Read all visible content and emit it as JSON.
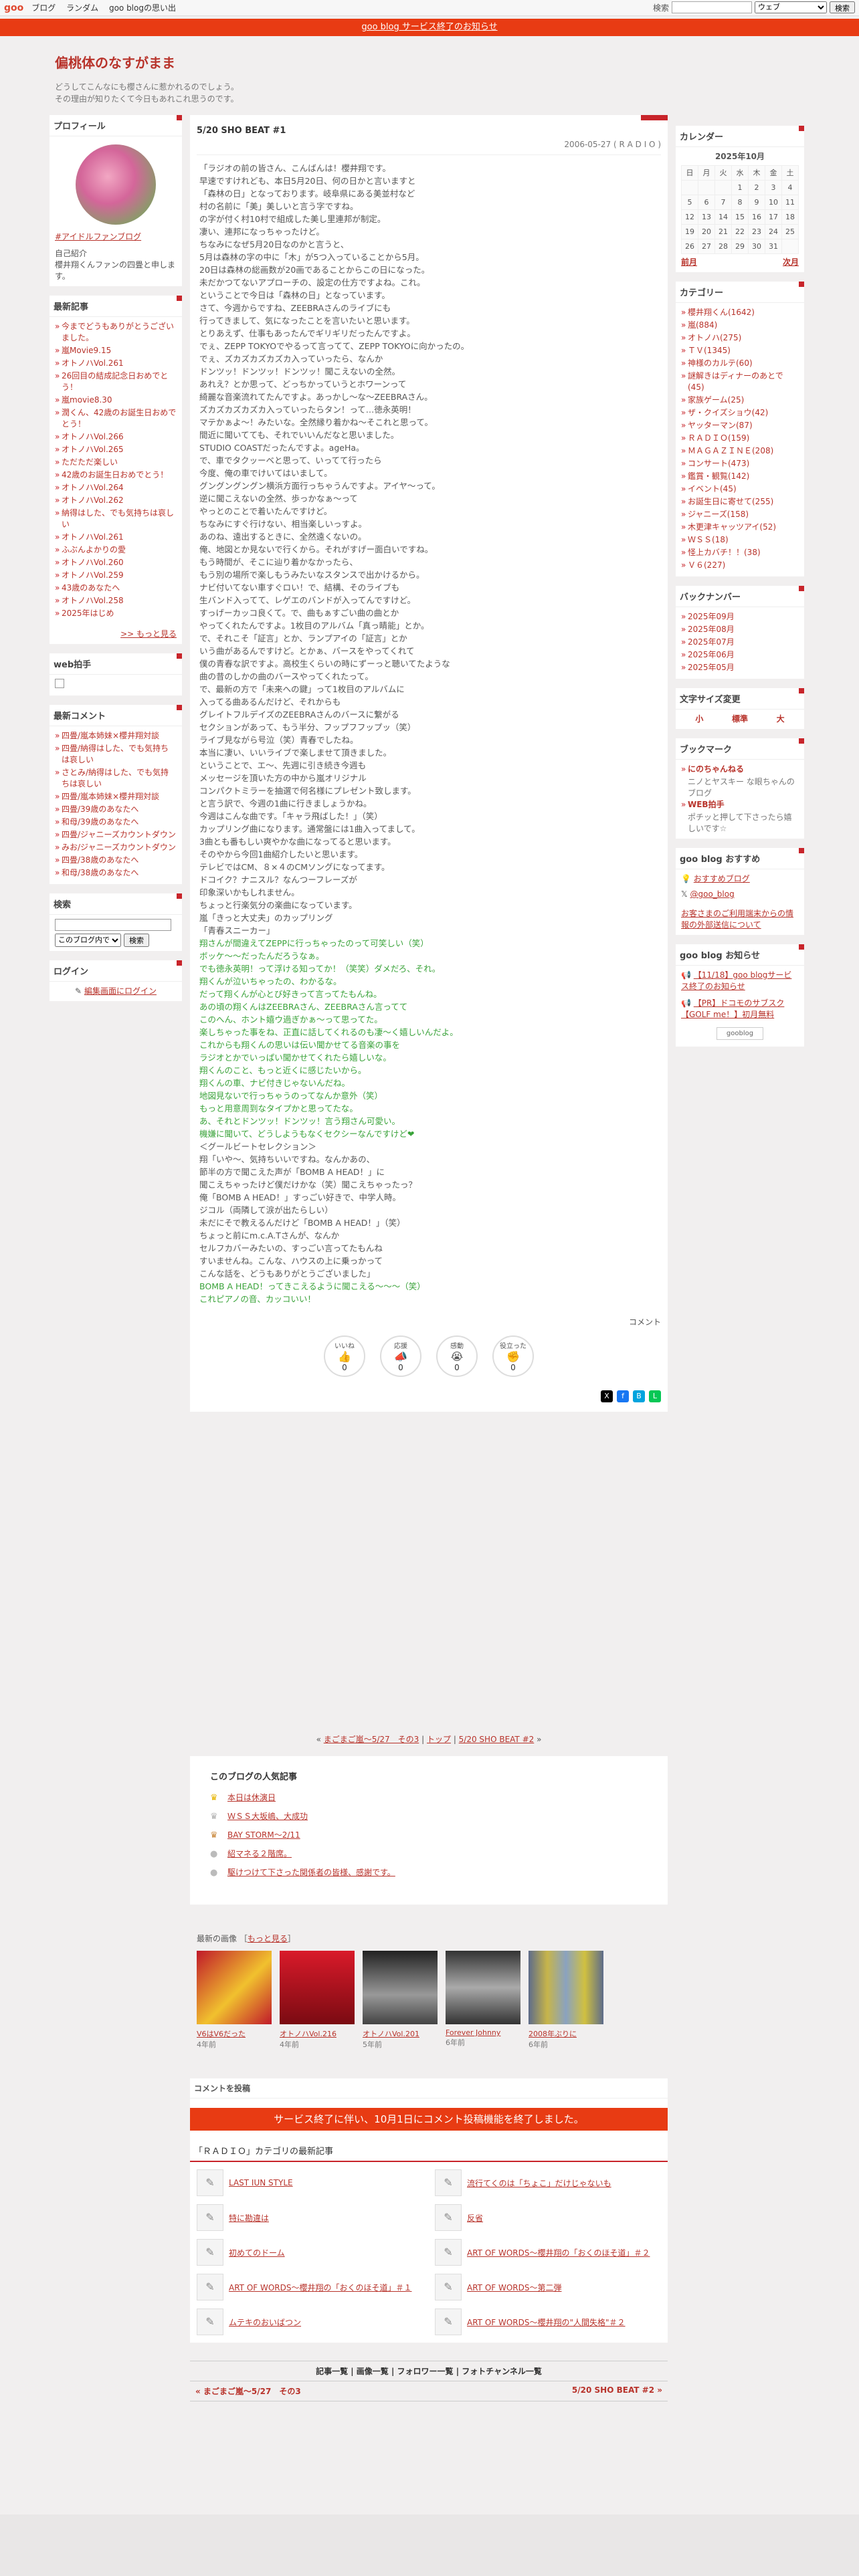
{
  "topbar": {
    "logo": "goo",
    "links": [
      "ブログ",
      "ランダム",
      "goo blogの思い出"
    ],
    "search_label": "検索",
    "search_select": "ウェブ",
    "search_button": "検索"
  },
  "notice": "goo blog サービス終了のお知らせ",
  "blog": {
    "title": "偏桃体のなすがまま",
    "desc1": "どうしてこんなにも櫻さんに惹かれるのでしょう。",
    "desc2": "その理由が知りたくて今日もあれこれ思うのです。"
  },
  "profile": {
    "title": "プロフィール",
    "name": "#アイドルファンブログ",
    "intro_label": "自己紹介",
    "intro": "櫻井翔くんファンの四畳と申します。"
  },
  "recent": {
    "title": "最新記事",
    "items": [
      "今までどうもありがとうございました。",
      "嵐Movie9.15",
      "オトノハVol.261",
      "26回目の結成記念日おめでとう！",
      "嵐movie8.30",
      "潤くん、42歳のお誕生日おめでとう！",
      "オトノハVol.266",
      "オトノハVol.265",
      "ただただ楽しい",
      "42歳のお誕生日おめでとう！",
      "オトノハVol.264",
      "オトノハVol.262",
      "納得はした、でも気持ちは哀しい",
      "オトノハVol.261",
      "ふぶんよかりの愛",
      "オトノハVol.260",
      "オトノハVol.259",
      "43歳のあなたへ",
      "オトノハVol.258",
      "2025年はじめ"
    ],
    "more": ">> もっと見る"
  },
  "webclap": {
    "title": "web拍手"
  },
  "comments": {
    "title": "最新コメント",
    "items": [
      "四畳/嵐本姉妹×櫻井翔対談",
      "四畳/納得はした、でも気持ちは哀しい",
      "さとみ/納得はした、でも気持ちは哀しい",
      "四畳/嵐本姉妹×櫻井翔対談",
      "四畳/39歳のあなたへ",
      "和母/39歳のあなたへ",
      "四畳/ジャニーズカウントダウン",
      "みお/ジャニーズカウントダウン",
      "四畳/38歳のあなたへ",
      "和母/38歳のあなたへ"
    ]
  },
  "searchbox": {
    "title": "検索",
    "select": "このブログ内で",
    "button": "検索"
  },
  "login": {
    "title": "ログイン",
    "link": "編集画面にログイン"
  },
  "post": {
    "title": "5/20 SHO BEAT #1",
    "date": "2006-05-27 ( R A D I O )",
    "lines": [
      {
        "t": "「ラジオの前の皆さん、こんばんは！櫻井翔です。",
        "g": false
      },
      {
        "t": "早速ですけれども、本日5月20日、何の日かと言いますと",
        "g": false
      },
      {
        "t": "「森林の日」となっております。岐阜県にある美並村など",
        "g": false
      },
      {
        "t": "村の名前に「美」美しいと言う字ですね。",
        "g": false
      },
      {
        "t": "の字が付く村10村で組成した美し里連邦が制定。",
        "g": false
      },
      {
        "t": "凄い、連邦になっちゃったけど。",
        "g": false
      },
      {
        "t": "ちなみになぜ5月20日なのかと言うと、",
        "g": false
      },
      {
        "t": "5月は森林の字の中に「木」が5つ入っていることから5月。",
        "g": false
      },
      {
        "t": "20日は森林の総画数が20画であることからこの日になった。",
        "g": false
      },
      {
        "t": "未だかつてないアプローチの、設定の仕方ですよね。これ。",
        "g": false
      },
      {
        "t": "ということで今日は「森林の日」となっています。",
        "g": false
      },
      {
        "t": "さて、今週からですね、ZEEBRAさんのライブにも",
        "g": false
      },
      {
        "t": "行ってきまして、気になったことを言いたいと思います。",
        "g": false
      },
      {
        "t": "とりあえず、仕事もあったんでギリギリだったんですよ。",
        "g": false
      },
      {
        "t": "でぇ、ZEPP TOKYOでやるって言ってて、ZEPP TOKYOに向かったの。",
        "g": false
      },
      {
        "t": "でぇ、ズカズカズカズカ入っていったら、なんか",
        "g": false
      },
      {
        "t": "ドンツッ！ドンツッ！ドンツッ！聞こえないの全然。",
        "g": false
      },
      {
        "t": "あれえ？とか思って、どっちかっていうとホワーンって",
        "g": false
      },
      {
        "t": "綺麗な音楽流れてたんですよ。あっかし〜な〜ZEEBRAさん。",
        "g": false
      },
      {
        "t": "ズカズカズカズカ入っていったらタン！って…徳永英明！",
        "g": false
      },
      {
        "t": "マテかぁよ〜！みたいな。全然縁り着かね〜そこれと思って。",
        "g": false
      },
      {
        "t": "間近に聞いてても、それでいいんだなと思いました。",
        "g": false
      },
      {
        "t": "STUDIO COASTだったんですよ。ageHa。",
        "g": false
      },
      {
        "t": "で、車でタクッーベと思って、いってて行ったら",
        "g": false
      },
      {
        "t": "今度、俺の車でけいてはいまして。",
        "g": false
      },
      {
        "t": "グングングングン横浜方面行っちゃうんですよ。アイヤ〜って。",
        "g": false
      },
      {
        "t": "逆に聞こえないの全然、歩っかなぁ〜って",
        "g": false
      },
      {
        "t": "やっとのことで着いたんですけど。",
        "g": false
      },
      {
        "t": "ちなみにすぐ行けない、相当楽しいっすよ。",
        "g": false
      },
      {
        "t": "あのね、遠出するときに、全然遠くないの。",
        "g": false
      },
      {
        "t": "俺、地図とか見ないで行くから。それがすげー面白いですね。",
        "g": false
      },
      {
        "t": "もう時間が、そこに辿り着かなかったら、",
        "g": false
      },
      {
        "t": "もう別の場所で楽しもうみたいなスタンスで出かけるから。",
        "g": false
      },
      {
        "t": "ナビ付いてない車すぐロい！で、結構、そのライブも",
        "g": false
      },
      {
        "t": "生バンド入ってて、レゲエのバンドが入ってんですけど。",
        "g": false
      },
      {
        "t": "すっげーカッコ良くて。で、曲もぁすごい曲の曲とか",
        "g": false
      },
      {
        "t": "やってくれたんですよ。1枚目のアルバム「真っ睛能」とか。",
        "g": false
      },
      {
        "t": "で、それこそ「証言」とか、ランプアイの「証言」とか",
        "g": false
      },
      {
        "t": "いう曲があるんですけど。とかぁ、バースをやってくれて",
        "g": false
      },
      {
        "t": "僕の青春な訳ですよ。高校生くらいの時にずーっと聴いてたような",
        "g": false
      },
      {
        "t": "曲の昔のしかの曲のバースやってくれたって。",
        "g": false
      },
      {
        "t": "で、最新の方で「未来への鍵」って1枚目のアルバムに",
        "g": false
      },
      {
        "t": "入ってる曲あるんだけど、それからも",
        "g": false
      },
      {
        "t": "グレイトフルデイズのZEEBRAさんのバースに繋がる",
        "g": false
      },
      {
        "t": "セクションがあって、もう半分、フップフフップッ（笑）",
        "g": false
      },
      {
        "t": "ライブ見ながら号泣（笑）青春でしたね。",
        "g": false
      },
      {
        "t": "本当に凄い、いいライブで楽しませて頂きました。",
        "g": false
      },
      {
        "t": "ということで、エ〜、先週に引き続き今週も",
        "g": false
      },
      {
        "t": "メッセージを頂いた方の中から嵐オリジナル",
        "g": false
      },
      {
        "t": "コンパクトミラーを抽選で何名様にプレゼント致します。",
        "g": false
      },
      {
        "t": "と言う訳で、今週の1曲に行きましょうかね。",
        "g": false
      },
      {
        "t": "今週はこんな曲です。「キャラ飛ばした！」（笑）",
        "g": false
      },
      {
        "t": "カップリング曲になります。通常盤には1曲入ってまして。",
        "g": false
      },
      {
        "t": "3曲とも番もしい爽やかな曲になってると思います。",
        "g": false
      },
      {
        "t": "そのやから今回1曲紹介したいと思います。",
        "g": false
      },
      {
        "t": "テレビではCM、８×４のCMソングになってます。",
        "g": false
      },
      {
        "t": "ドコイク？ナニスル？なんつーフレーズが",
        "g": false
      },
      {
        "t": "印象深いかもしれません。",
        "g": false
      },
      {
        "t": "ちょっと行楽気分の楽曲になっています。",
        "g": false
      },
      {
        "t": "嵐「きっと大丈夫」のカップリング",
        "g": false
      },
      {
        "t": "「青春スニーカー」",
        "g": false
      },
      {
        "t": "翔さんが間違えてZEPPに行っちゃったのって可笑しい（笑）",
        "g": true
      },
      {
        "t": "ボッケ〜〜だったんだろうなぁ。",
        "g": true
      },
      {
        "t": "でも徳永英明！って浮ける知ってか！（笑笑）ダメだろ、それ。",
        "g": true
      },
      {
        "t": "翔くんが泣いちゃったの、わかるな。",
        "g": true
      },
      {
        "t": "だって翔くんが心とび好きって言ってたもんね。",
        "g": true
      },
      {
        "t": "あの頃の翔くんはZEEBRAさん、ZEEBRAさん言ってて",
        "g": true
      },
      {
        "t": "このへん、ホント嬉ウ過ぎかぁ〜って思ってた。",
        "g": true
      },
      {
        "t": "楽しちゃった事をね、正直に話してくれるのも凄〜く嬉しいんだよ。",
        "g": true
      },
      {
        "t": "これからも翔くんの思いは伝い聞かせてる音楽の事を",
        "g": true
      },
      {
        "t": "ラジオとかでいっぱい聞かせてくれたら嬉しいな。",
        "g": true
      },
      {
        "t": "翔くんのこと、もっと近くに感じたいから。",
        "g": true
      },
      {
        "t": "翔くんの車、ナビ付きじゃないんだね。",
        "g": true
      },
      {
        "t": "地図見ないで行っちゃうのってなんか意外（笑）",
        "g": true
      },
      {
        "t": "もっと用意周到なタイプかと思ってたな。",
        "g": true
      },
      {
        "t": "あ、それとドンツッ！ドンツッ！言う翔さん可愛い。",
        "g": true
      },
      {
        "t": "機嫌に聞いて、どうしようもなくセクシーなんですけど❤",
        "g": true
      },
      {
        "t": "＜グールビートセレクション＞",
        "g": false
      },
      {
        "t": "翔「いや〜、気持ちいいですね。なんかあの、",
        "g": false
      },
      {
        "t": "節半の方で聞こえた声が「BOMB A HEAD！」に",
        "g": false
      },
      {
        "t": "聞こえちゃったけど僕だけかな（笑）聞こえちゃったっ？",
        "g": false
      },
      {
        "t": "俺「BOMB A HEAD！」すっごい好きで、中学人時。",
        "g": false
      },
      {
        "t": "ジコル（両隣して涙が出たらしい）",
        "g": false
      },
      {
        "t": "未だにそで教えるんだけど「BOMB A HEAD！」（笑）",
        "g": false
      },
      {
        "t": "ちょっと前にm.c.A.Tさんが、なんか",
        "g": false
      },
      {
        "t": "セルフカバーみたいの、すっごい言ってたもんね",
        "g": false
      },
      {
        "t": "すいませんね。こんな、ハウスの上に乗っかって",
        "g": false
      },
      {
        "t": "こんな話を、どうもありがとうございました」",
        "g": false
      },
      {
        "t": "BOMB A HEAD！ってきこえるように聞こえる〜〜〜（笑）",
        "g": true
      },
      {
        "t": "これピアノの音、カッコいい！",
        "g": true
      }
    ],
    "comment_label": "コメント",
    "reactions": [
      {
        "label": "いいね",
        "icon": "👍",
        "count": "0"
      },
      {
        "label": "応援",
        "icon": "📣",
        "count": "0"
      },
      {
        "label": "感動",
        "icon": "😭",
        "count": "0"
      },
      {
        "label": "役立った",
        "icon": "✊",
        "count": "0"
      }
    ]
  },
  "nav": {
    "prev": "まごまご嵐〜5/27　その3",
    "top": "トップ",
    "next": "5/20 SHO BEAT #2",
    "sep": " | "
  },
  "popular": {
    "title": "このブログの人気記事",
    "items": [
      "本日は休演日",
      "ＷＳＳ大坂嶋、大成功",
      "BAY STORM〜2/11",
      "紹マネる２階席。",
      "駆けつけて下さった関係者の皆様、感謝です。"
    ]
  },
  "latest": {
    "head": "最新の画像",
    "more": "もっと見る",
    "items": [
      {
        "t": "V6はV6だった",
        "a": "4年前"
      },
      {
        "t": "オトノハVol.216",
        "a": "4年前"
      },
      {
        "t": "オトノハVol.201",
        "a": "5年前"
      },
      {
        "t": "Forever Johnny",
        "a": "6年前"
      },
      {
        "t": "2008年ぶりに",
        "a": "6年前"
      }
    ]
  },
  "commentpost": {
    "title": "コメントを投稿",
    "banner": "サービス終了に伴い、10月1日にコメント投稿機能を終了しました。"
  },
  "category": {
    "head": "「ＲＡＤＩＯ」カテゴリの最新記事",
    "items": [
      "LAST IUN STYLE",
      "流行てくのは「ちょこ」だけじゃないも",
      "特に勘違は",
      "反省",
      "初めてのドーム",
      "ART OF WORDS〜櫻井翔の「おくのほそ道」＃２",
      "ART OF WORDS〜櫻井翔の「おくのほそ道」＃１",
      "ART OF WORDS〜第二弾",
      "ムテキのおいばつン",
      "ART OF WORDS〜櫻井翔の\"人間失格\"＃２"
    ]
  },
  "footlinks": "記事一覧 | 画像一覧 | フォロワー一覧 | フォトチャンネル一覧",
  "footnav": {
    "prev": "« まごまご嵐〜5/27　その3",
    "next": "5/20 SHO BEAT #2 »"
  },
  "calendar": {
    "title": "カレンダー",
    "month": "2025年10月",
    "days": [
      "日",
      "月",
      "火",
      "水",
      "木",
      "金",
      "土"
    ],
    "rows": [
      [
        "",
        "",
        "",
        "1",
        "2",
        "3",
        "4"
      ],
      [
        "5",
        "6",
        "7",
        "8",
        "9",
        "10",
        "11"
      ],
      [
        "12",
        "13",
        "14",
        "15",
        "16",
        "17",
        "18"
      ],
      [
        "19",
        "20",
        "21",
        "22",
        "23",
        "24",
        "25"
      ],
      [
        "26",
        "27",
        "28",
        "29",
        "30",
        "31",
        ""
      ]
    ],
    "prev": "前月",
    "next": "次月"
  },
  "categories": {
    "title": "カテゴリー",
    "items": [
      "櫻井翔くん(1642)",
      "嵐(884)",
      "オトノハ(275)",
      "ＴＶ(1345)",
      "神様のカルテ(60)",
      "謎解きはディナーのあとで(45)",
      "家族ゲーム(25)",
      "ザ・クイズショウ(42)",
      "ヤッターマン(87)",
      "ＲＡＤＩＯ(159)",
      "ＭＡＧＡＺＩＮＥ(208)",
      "コンサート(473)",
      "鑑賞・観覧(142)",
      "イベント(45)",
      "お誕生日に寄せて(255)",
      "ジャニーズ(158)",
      "木更津キャッツアイ(52)",
      "ＷＳＳ(18)",
      "怪上カバチ！！(38)",
      "Ｖ６(227)"
    ]
  },
  "backnumber": {
    "title": "バックナンバー",
    "items": [
      "2025年09月",
      "2025年08月",
      "2025年07月",
      "2025年06月",
      "2025年05月"
    ]
  },
  "fontsize": {
    "title": "文字サイズ変更",
    "items": [
      "小",
      "標準",
      "大"
    ]
  },
  "bookmark": {
    "title": "ブックマーク",
    "items": [
      {
        "t": "にのちゃんねる",
        "d": "ニノとヤスキー な眼ちゃんのブログ"
      },
      {
        "t": "WEB拍手",
        "d": "ポチッと押して下さったら嬉しいです☆"
      }
    ]
  },
  "goorec": {
    "title": "goo blog おすすめ",
    "items": [
      "おすすめブログ",
      "@goo_blog"
    ],
    "note": "お客さまのご利用端末からの情報の外部送信について"
  },
  "goonews": {
    "title": "goo blog お知らせ",
    "items": [
      "【11/18】goo blogサービス終了のお知らせ",
      "【PR】ドコモのサブスク【GOLF me！】初月無料"
    ],
    "badge": "gooblog"
  }
}
